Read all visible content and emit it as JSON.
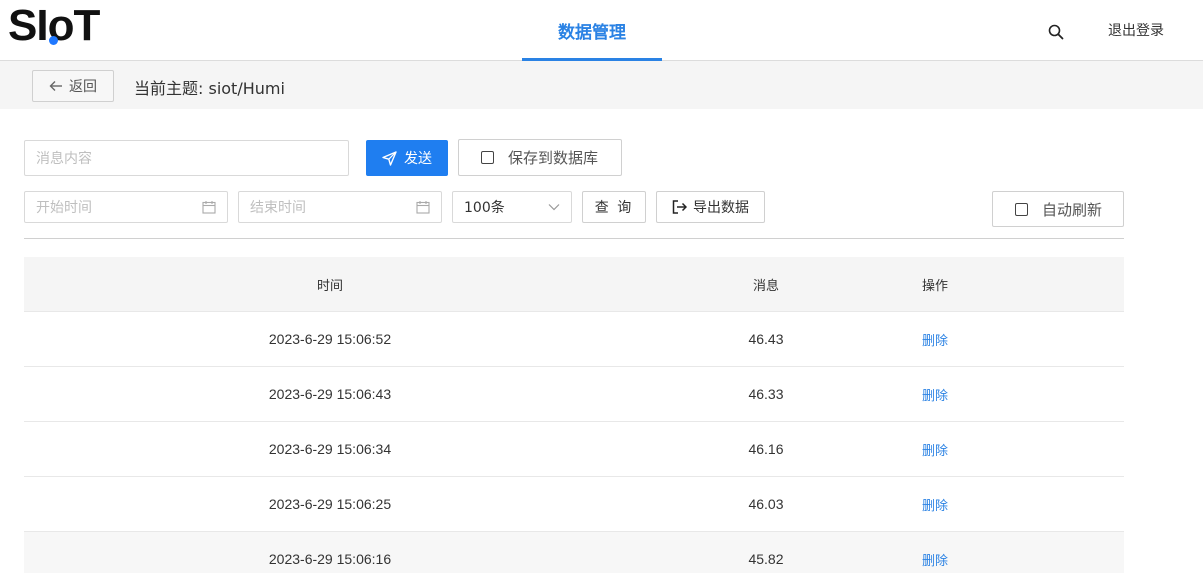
{
  "header": {
    "logo_text_s": "S",
    "logo_text_i": "I",
    "logo_text_o": "o",
    "logo_text_t": "T",
    "nav_tab": "数据管理",
    "logout": "退出登录",
    "search_icon": "search-icon"
  },
  "topic_bar": {
    "back_label": "返回",
    "topic_title": "当前主题: siot/Humi"
  },
  "send_row": {
    "message_placeholder": "消息内容",
    "message_value": "",
    "send_label": "发送",
    "save_db_label": "保存到数据库",
    "save_db_checked": false
  },
  "query_row": {
    "start_placeholder": "开始时间",
    "end_placeholder": "结束时间",
    "limit_value": "100条",
    "query_label": "查 询",
    "export_label": "导出数据",
    "auto_refresh_label": "自动刷新",
    "auto_refresh_checked": false
  },
  "table": {
    "columns": [
      "时间",
      "消息",
      "操作"
    ],
    "rows": [
      {
        "time": "2023-6-29 15:06:52",
        "message": "46.43",
        "action": "删除"
      },
      {
        "time": "2023-6-29 15:06:43",
        "message": "46.33",
        "action": "删除"
      },
      {
        "time": "2023-6-29 15:06:34",
        "message": "46.16",
        "action": "删除"
      },
      {
        "time": "2023-6-29 15:06:25",
        "message": "46.03",
        "action": "删除"
      },
      {
        "time": "2023-6-29 15:06:16",
        "message": "45.82",
        "action": "删除"
      }
    ]
  },
  "colors": {
    "accent": "#2a82e4",
    "send_button": "#1f7ef0",
    "logo_dot": "#1f78ff"
  }
}
